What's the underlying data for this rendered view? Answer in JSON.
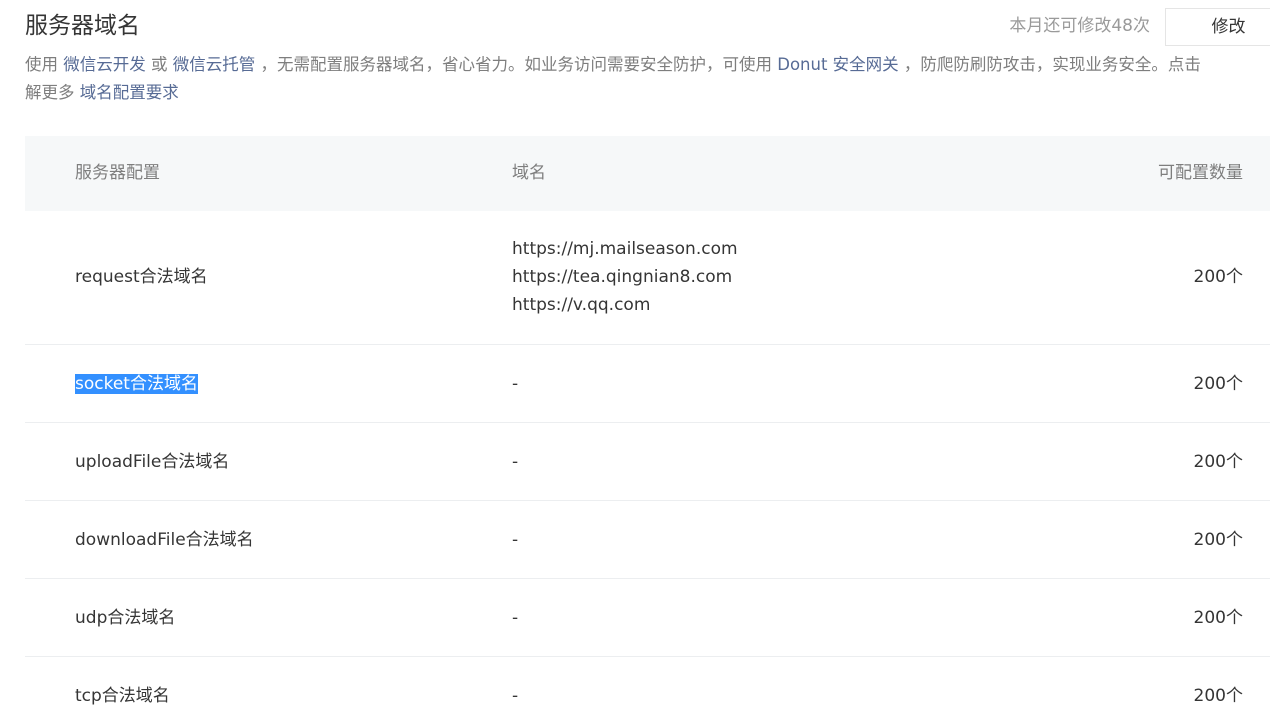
{
  "header": {
    "title": "服务器域名",
    "remaining_text": "本月还可修改48次",
    "modify_label": "修改"
  },
  "description": {
    "part1": "使用 ",
    "link1": "微信云开发",
    "part2": " 或 ",
    "link2": "微信云托管",
    "part3": " ，无需配置服务器域名，省心省力。如业务访问需要安全防护，可使用 ",
    "link3": "Donut 安全网关",
    "part4": " ，防爬防刷防攻击，实现业务安全。点击",
    "part5": "解更多 ",
    "link4": "域名配置要求"
  },
  "table": {
    "headers": {
      "config": "服务器配置",
      "domain": "域名",
      "quota": "可配置数量"
    },
    "rows": [
      {
        "name": "request合法域名",
        "domains": [
          "https://mj.mailseason.com",
          "https://tea.qingnian8.com",
          "https://v.qq.com"
        ],
        "quota": "200个"
      },
      {
        "name": "socket合法域名",
        "domain": "-",
        "quota": "200个",
        "selected": true
      },
      {
        "name": "uploadFile合法域名",
        "domain": "-",
        "quota": "200个"
      },
      {
        "name": "downloadFile合法域名",
        "domain": "-",
        "quota": "200个"
      },
      {
        "name": "udp合法域名",
        "domain": "-",
        "quota": "200个"
      },
      {
        "name": "tcp合法域名",
        "domain": "-",
        "quota": "200个"
      }
    ]
  },
  "colors": {
    "link": "#576b95",
    "selection": "#3390ff",
    "header_bg": "#f6f8f9"
  }
}
